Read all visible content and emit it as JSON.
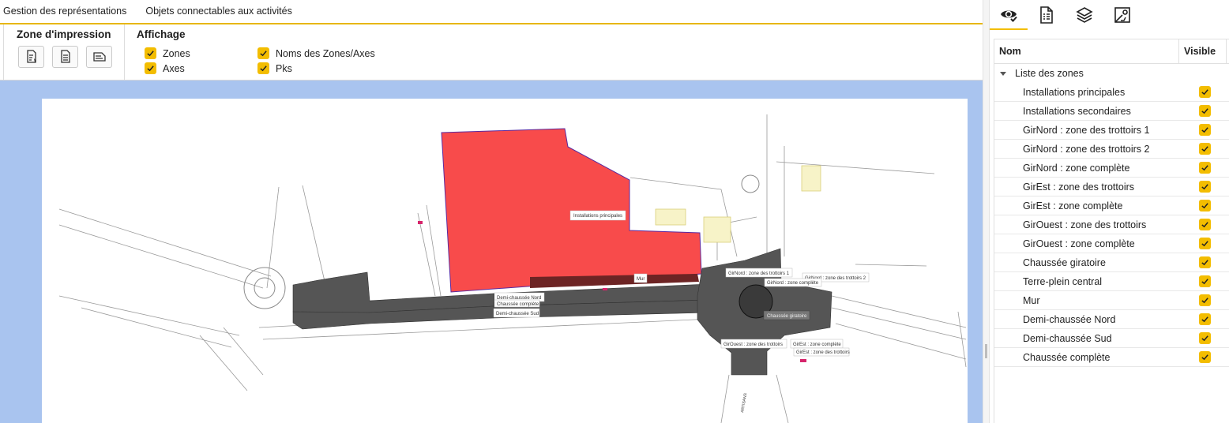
{
  "menu": {
    "items": [
      "Gestion des représentations",
      "Objets connectables aux activités"
    ]
  },
  "ribbon": {
    "print_zone_title": "Zone d'impression",
    "display_title": "Affichage",
    "checkboxes": {
      "zones": {
        "label": "Zones",
        "checked": true
      },
      "axes": {
        "label": "Axes",
        "checked": true
      },
      "names": {
        "label": "Noms des Zones/Axes",
        "checked": true
      },
      "pks": {
        "label": "Pks",
        "checked": true
      }
    },
    "print_buttons": [
      "print-zone-edit-icon",
      "print-zone-document-icon",
      "print-zone-landscape-icon"
    ]
  },
  "map_labels": {
    "installations_principales": "Installations principales",
    "mur": "Mur",
    "demi_chaussee_nord": "Demi-chaussée Nord",
    "demi_chaussee_sud": "Demi-chaussée Sud",
    "chaussee_complete": "Chaussée complète",
    "girnord_trottoirs_1": "GirNord : zone des trottoirs 1",
    "girnord_trottoirs_2": "GirNord : zone des trottoirs 2",
    "girnord_complete": "GirNord : zone complète",
    "chaussee_giratoire": "Chaussée giratoire",
    "girouest_trottoirs": "GirOuest : zone des trottoirs",
    "girest_complete": "GirEst : zone complète",
    "girest_trottoirs": "GirEst : zone des trottoirs",
    "street_label": "ARTISANS"
  },
  "colors": {
    "accent": "#f3bd00",
    "canvas_background": "#a9c4ef",
    "zone_main": "#f84b4b",
    "zone_road": "#555555"
  },
  "right_panel": {
    "tabs": [
      "visibility-eye-icon",
      "document-list-icon",
      "layers-icon",
      "map-image-icon"
    ],
    "active_tab": 0,
    "column_name": "Nom",
    "column_visible": "Visible",
    "group_label": "Liste des zones",
    "zones": [
      {
        "name": "Installations principales",
        "visible": true
      },
      {
        "name": "Installations secondaires",
        "visible": true
      },
      {
        "name": "GirNord : zone des trottoirs 1",
        "visible": true
      },
      {
        "name": "GirNord : zone des trottoirs 2",
        "visible": true
      },
      {
        "name": "GirNord : zone complète",
        "visible": true
      },
      {
        "name": "GirEst : zone des trottoirs",
        "visible": true
      },
      {
        "name": "GirEst : zone complète",
        "visible": true
      },
      {
        "name": "GirOuest : zone des trottoirs",
        "visible": true
      },
      {
        "name": "GirOuest : zone complète",
        "visible": true
      },
      {
        "name": "Chaussée giratoire",
        "visible": true
      },
      {
        "name": "Terre-plein central",
        "visible": true
      },
      {
        "name": "Mur",
        "visible": true
      },
      {
        "name": "Demi-chaussée Nord",
        "visible": true
      },
      {
        "name": "Demi-chaussée Sud",
        "visible": true
      },
      {
        "name": "Chaussée complète",
        "visible": true
      }
    ]
  }
}
